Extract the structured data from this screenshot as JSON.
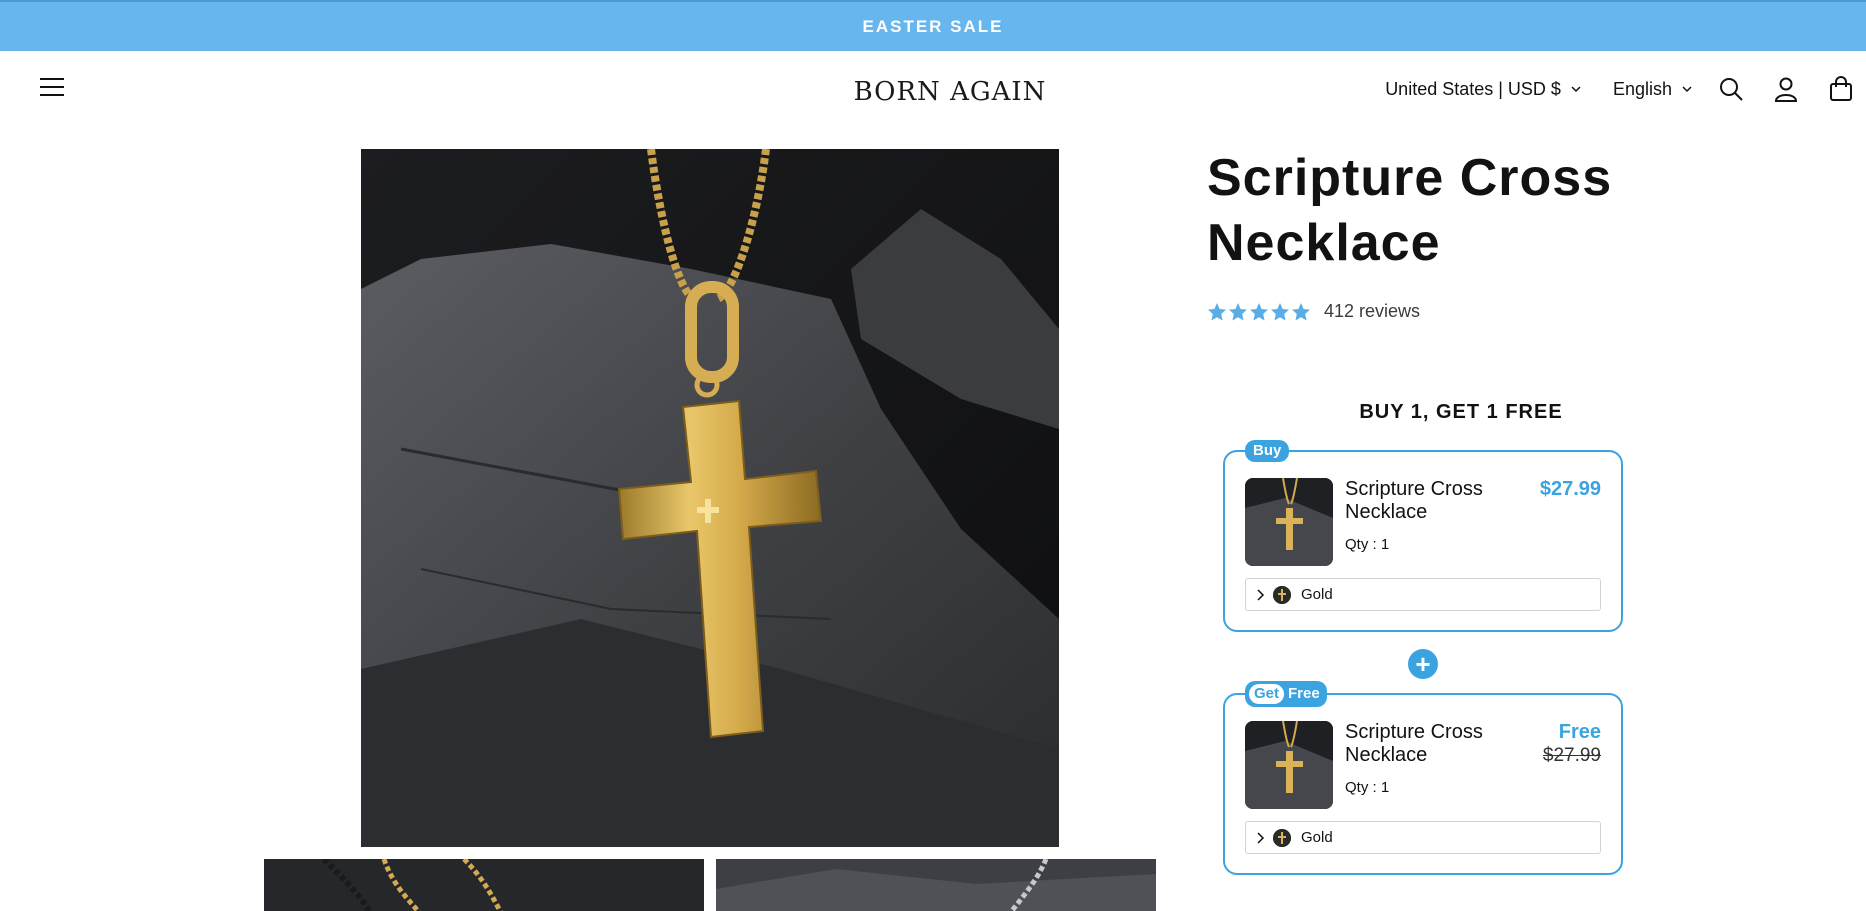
{
  "announcement": {
    "text": "EASTER SALE"
  },
  "header": {
    "logo_text": "BORN AGAIN",
    "country": "United States | USD $",
    "language": "English",
    "icons": [
      "menu-icon",
      "search-icon",
      "account-icon",
      "cart-icon"
    ]
  },
  "product": {
    "title": "Scripture Cross Necklace",
    "rating": 5,
    "reviews": "412 reviews"
  },
  "offer": {
    "title": "BUY 1, GET 1 FREE",
    "plus": "+",
    "buy": {
      "tag": "Buy",
      "name": "Scripture Cross Necklace",
      "price": "$27.99",
      "qty": "Qty : 1",
      "variant": "Gold"
    },
    "get": {
      "tag_get": "Get",
      "tag_free": "Free",
      "name": "Scripture Cross Necklace",
      "price": "Free",
      "old_price": "$27.99",
      "qty": "Qty : 1",
      "variant": "Gold"
    }
  },
  "colors": {
    "announcement_bg": "#67b6ee",
    "accent": "#3aa3e0",
    "star": "#5aaee8"
  }
}
